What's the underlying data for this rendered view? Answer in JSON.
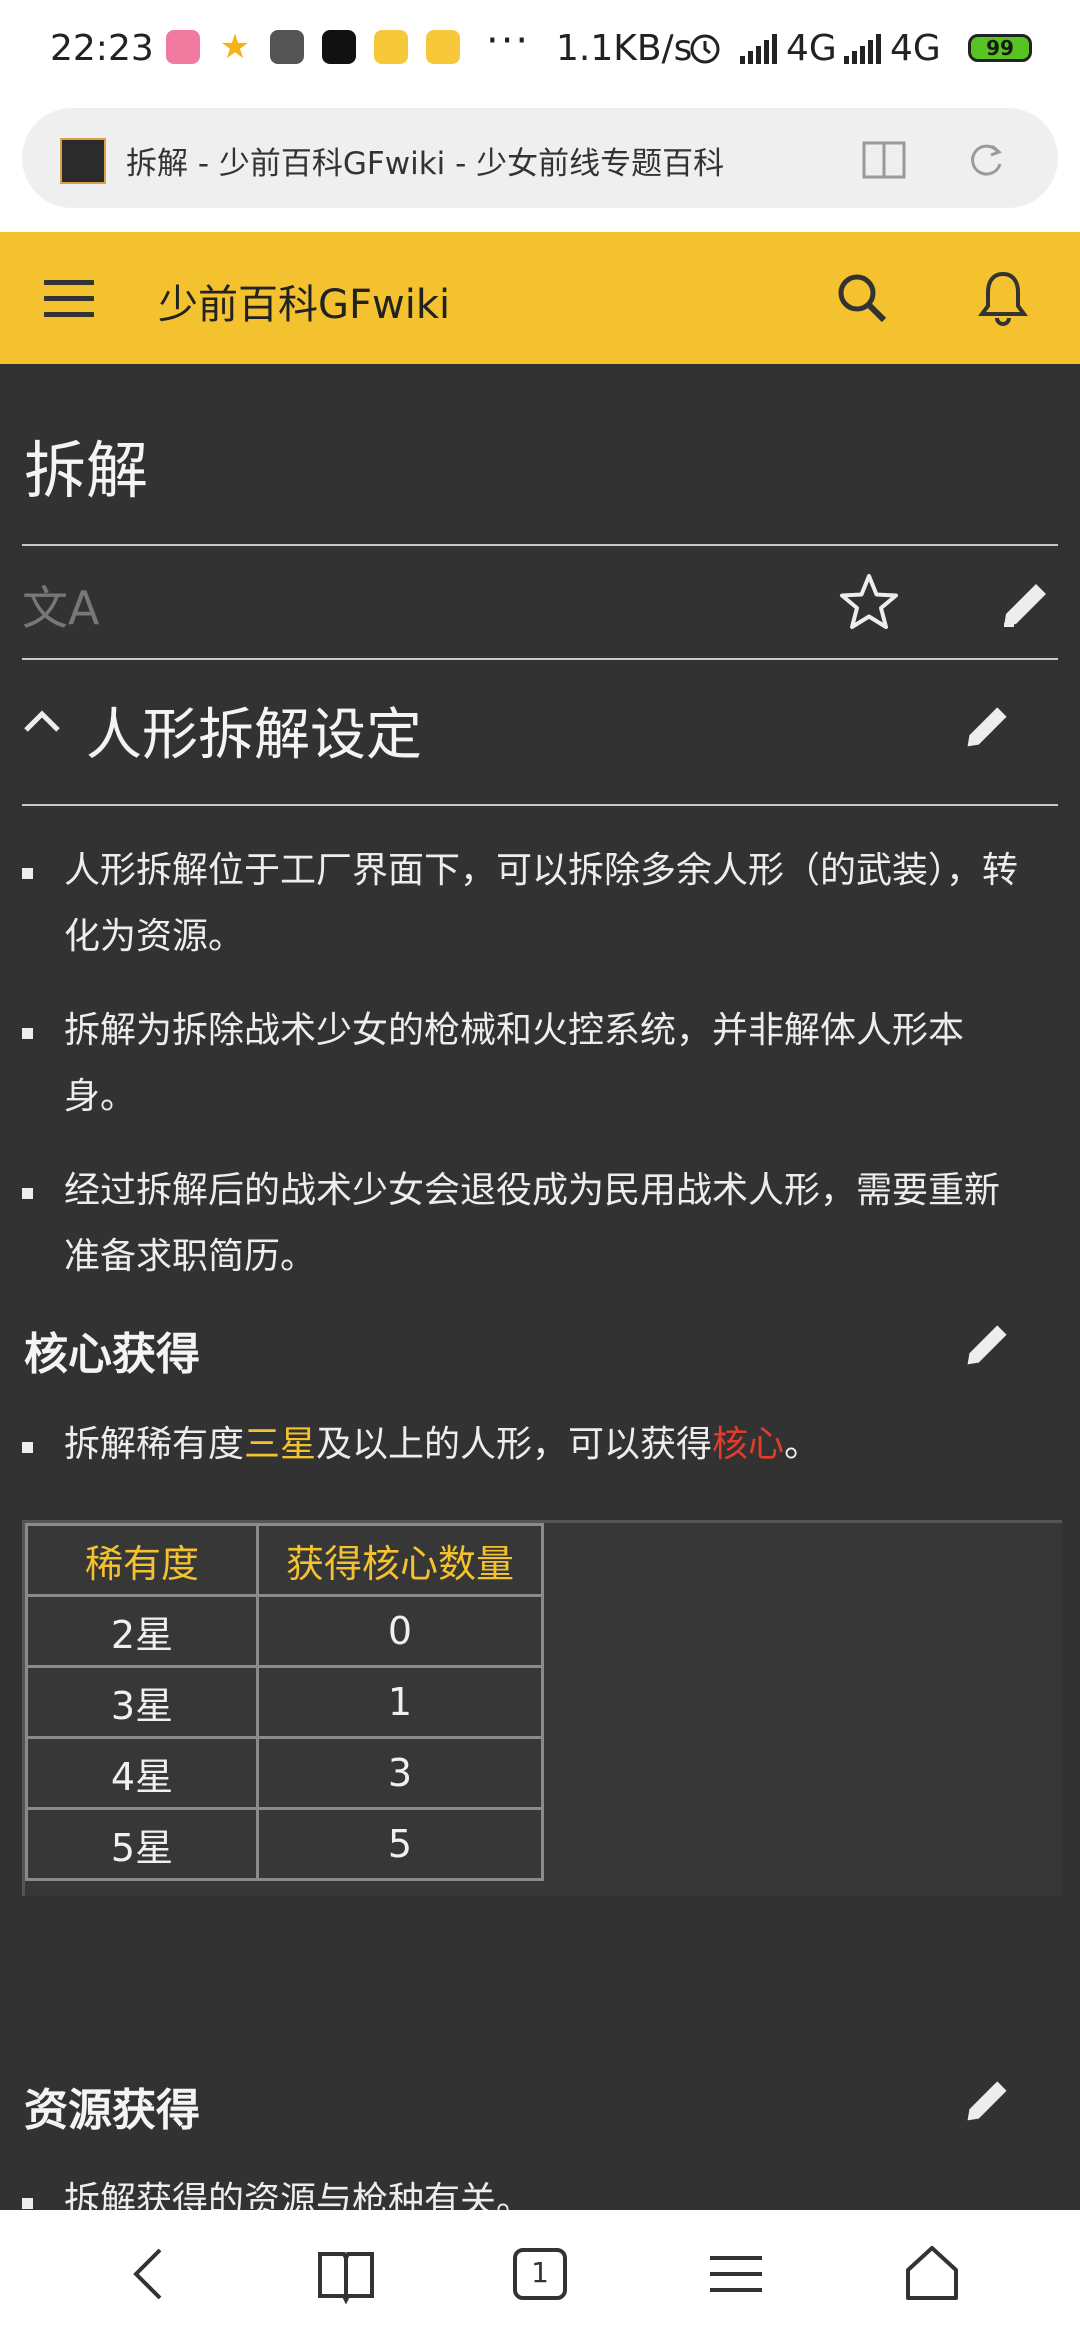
{
  "status_bar": {
    "time": "22:23",
    "network_speed": "1.1KB/s",
    "signal_label_1": "4G",
    "signal_label_2": "4G",
    "battery": "99",
    "more": "···",
    "app_icons": [
      {
        "name": "pink-app-icon",
        "color": "#f07aa0"
      },
      {
        "name": "star-app-icon",
        "color": "#f5b21a"
      },
      {
        "name": "mi-app-icon",
        "color": "#555555"
      },
      {
        "name": "soul-app-icon",
        "color": "#111111"
      },
      {
        "name": "video-app-icon",
        "color": "#f6c83a"
      },
      {
        "name": "video-app-icon-2",
        "color": "#f6c83a"
      }
    ]
  },
  "browser": {
    "page_title": "拆解 - 少前百科GFwiki - 少女前线专题百科"
  },
  "header": {
    "site_name": "少前百科GFwiki"
  },
  "article": {
    "title": "拆解",
    "section_title": "人形拆解设定",
    "bullets": [
      "人形拆解位于工厂界面下，可以拆除多余人形（的武装），转化为资源。",
      "拆解为拆除战术少女的枪械和火控系统，并非解体人形本身。",
      "经过拆解后的战术少女会退役成为民用战术人形，需要重新准备求职简历。"
    ],
    "core_section": {
      "title": "核心获得",
      "text_before": "拆解稀有度",
      "highlight_rarity": "三星",
      "text_middle": "及以上的人形，可以获得",
      "highlight_core": "核心",
      "text_after": "。"
    },
    "core_table": {
      "headers": [
        "稀有度",
        "获得核心数量"
      ],
      "rows": [
        [
          "2星",
          "0"
        ],
        [
          "3星",
          "1"
        ],
        [
          "4星",
          "3"
        ],
        [
          "5星",
          "5"
        ]
      ]
    },
    "resource_section": {
      "title": "资源获得",
      "first_bullet": "拆解获得的资源与枪种有关。"
    }
  },
  "bottom_nav": {
    "tab_count": "1"
  },
  "colors": {
    "accent": "#f3c22e",
    "background": "#323232",
    "highlight_red": "#e13c2c"
  }
}
